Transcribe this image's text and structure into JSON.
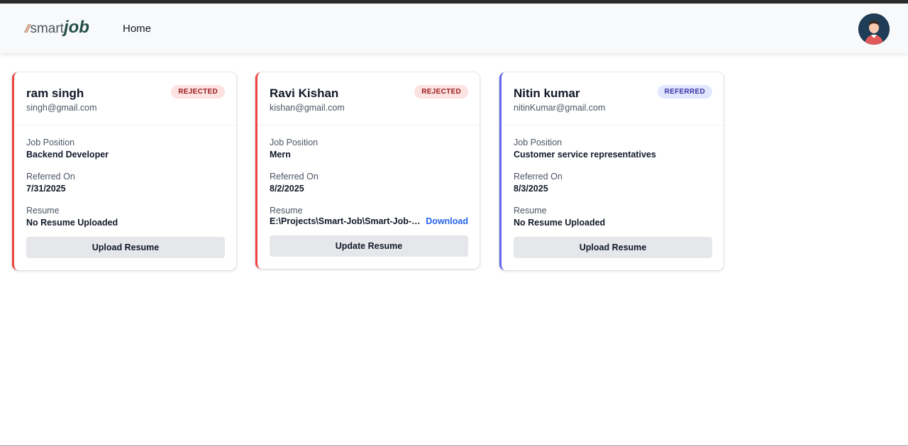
{
  "header": {
    "logo_slashes": "//",
    "logo_smart": "smart",
    "logo_job": "job",
    "nav_home": "Home"
  },
  "labels": {
    "job_position": "Job Position",
    "referred_on": "Referred On",
    "resume": "Resume"
  },
  "cards": [
    {
      "name": "ram singh",
      "email": "singh@gmail.com",
      "status": "REJECTED",
      "job_position": "Backend Developer",
      "referred_on": "7/31/2025",
      "resume": "No Resume Uploaded",
      "button": "Upload Resume"
    },
    {
      "name": "Ravi Kishan",
      "email": "kishan@gmail.com",
      "status": "REJECTED",
      "job_position": "Mern",
      "referred_on": "8/2/2025",
      "resume": "E:\\Projects\\Smart-Job\\Smart-Job-Referral-System\\uploads\\resume.pdf",
      "download": "Download",
      "button": "Update Resume"
    },
    {
      "name": "Nitin kumar",
      "email": "nitinKumar@gmail.com",
      "status": "REFERRED",
      "job_position": "Customer service representatives",
      "referred_on": "8/3/2025",
      "resume": "No Resume Uploaded",
      "button": "Upload Resume"
    }
  ],
  "colors": {
    "rejected_accent": "#ef4444",
    "referred_accent": "#6366f1",
    "link": "#2563eb",
    "logo_job": "#244e4a"
  }
}
